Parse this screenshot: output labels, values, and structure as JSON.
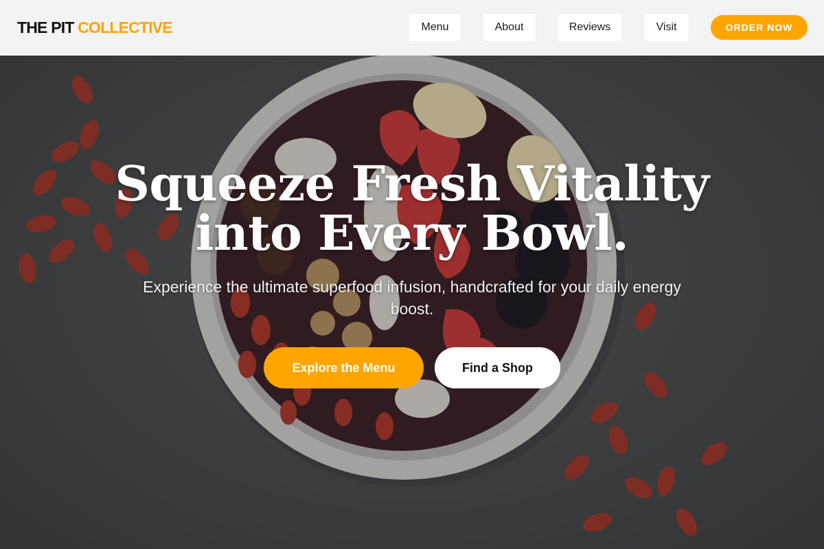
{
  "header": {
    "brand_part1": "THE PIT",
    "brand_part2": "COLLECTIVE",
    "nav": {
      "menu": "Menu",
      "about": "About",
      "reviews": "Reviews",
      "visit": "Visit"
    },
    "order_label": "ORDER NOW"
  },
  "hero": {
    "headline_line1": "Squeeze Fresh Vitality",
    "headline_line2": "into Every Bowl.",
    "subhead": "Experience the ultimate superfood infusion, handcrafted for your daily energy boost.",
    "cta_primary": "Explore the Menu",
    "cta_secondary": "Find a Shop"
  },
  "colors": {
    "accent": "#ffa500",
    "header_bg": "#f3f3f3",
    "hero_text": "#ffffff"
  }
}
